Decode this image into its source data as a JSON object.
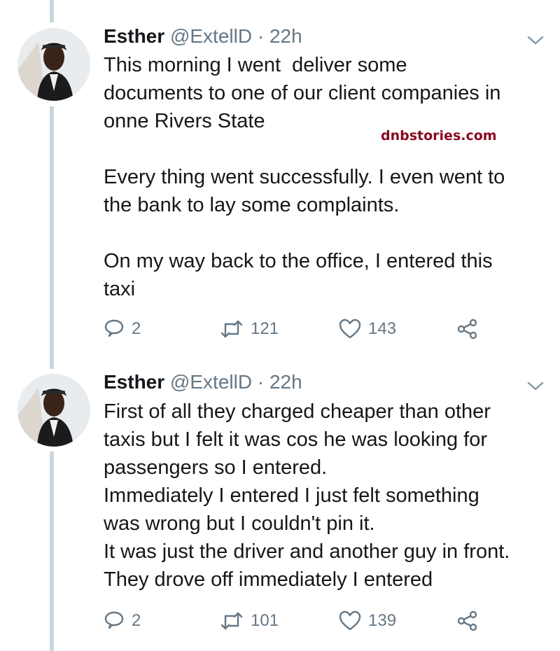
{
  "tweets": [
    {
      "author": {
        "name": "Esther",
        "handle": "@ExtellD"
      },
      "separator": "·",
      "time": "22h",
      "text": "This morning I went  deliver some\ndocuments to one of our client companies in\nonne Rivers State\n\nEvery thing went successfully. I even went to\nthe bank to lay some complaints.\n\nOn my way back to the office, I entered this\ntaxi",
      "watermark": "dnbstories.com",
      "replies": "2",
      "retweets": "121",
      "likes": "143"
    },
    {
      "author": {
        "name": "Esther",
        "handle": "@ExtellD"
      },
      "separator": "·",
      "time": "22h",
      "text": "First of all they charged cheaper than other\ntaxis but I felt it was cos he was looking for\npassengers so I entered.\nImmediately I entered I just felt something\nwas wrong but I couldn't pin it.\nIt was just the driver and another guy in front.\nThey drove off immediately I entered",
      "replies": "2",
      "retweets": "101",
      "likes": "139"
    }
  ],
  "colors": {
    "thread_line": "#ccd6dd",
    "secondary_text": "#657786",
    "watermark": "#8b0a1e"
  },
  "icons": [
    "reply-icon",
    "retweet-icon",
    "like-icon",
    "share-icon",
    "chevron-down-icon"
  ]
}
